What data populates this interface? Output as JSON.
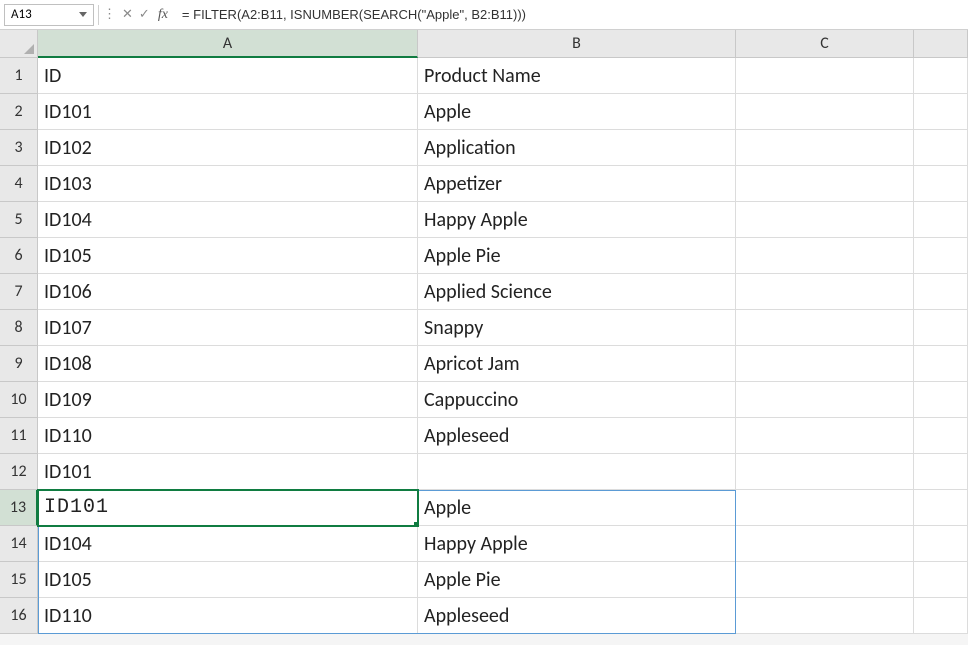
{
  "nameBox": "A13",
  "formula": "= FILTER(A2:B11, ISNUMBER(SEARCH(\"Apple\", B2:B11)))",
  "columns": [
    "A",
    "B",
    "C",
    ""
  ],
  "rows": [
    {
      "n": "1",
      "A": "ID",
      "B": "Product Name",
      "C": "",
      "D": ""
    },
    {
      "n": "2",
      "A": "ID101",
      "B": "Apple",
      "C": "",
      "D": ""
    },
    {
      "n": "3",
      "A": "ID102",
      "B": "Application",
      "C": "",
      "D": ""
    },
    {
      "n": "4",
      "A": "ID103",
      "B": "Appetizer",
      "C": "",
      "D": ""
    },
    {
      "n": "5",
      "A": "ID104",
      "B": "Happy Apple",
      "C": "",
      "D": ""
    },
    {
      "n": "6",
      "A": "ID105",
      "B": "Apple Pie",
      "C": "",
      "D": ""
    },
    {
      "n": "7",
      "A": "ID106",
      "B": "Applied Science",
      "C": "",
      "D": ""
    },
    {
      "n": "8",
      "A": "ID107",
      "B": "Snappy",
      "C": "",
      "D": ""
    },
    {
      "n": "9",
      "A": "ID108",
      "B": "Apricot Jam",
      "C": "",
      "D": ""
    },
    {
      "n": "10",
      "A": "ID109",
      "B": "Cappuccino",
      "C": "",
      "D": ""
    },
    {
      "n": "11",
      "A": "ID110",
      "B": "Appleseed",
      "C": "",
      "D": ""
    },
    {
      "n": "12",
      "A": "ID101",
      "B": "",
      "C": "",
      "D": ""
    },
    {
      "n": "13",
      "A": "ID101",
      "B": "Apple",
      "C": "",
      "D": ""
    },
    {
      "n": "14",
      "A": "ID104",
      "B": "Happy Apple",
      "C": "",
      "D": ""
    },
    {
      "n": "15",
      "A": "ID105",
      "B": "Apple Pie",
      "C": "",
      "D": ""
    },
    {
      "n": "16",
      "A": "ID110",
      "B": "Appleseed",
      "C": "",
      "D": ""
    }
  ],
  "activeCell": "A13",
  "selectedRow": 13,
  "selectedCol": "A",
  "spill": {
    "topRow": 13,
    "bottomRow": 16,
    "cols": [
      "A",
      "B"
    ]
  }
}
